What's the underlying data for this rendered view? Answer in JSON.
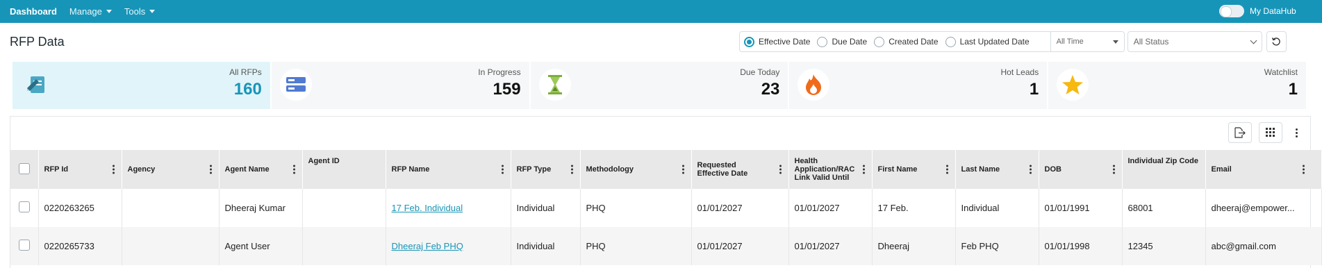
{
  "nav": {
    "items": [
      {
        "label": "Dashboard",
        "active": true,
        "dropdown": false
      },
      {
        "label": "Manage",
        "active": false,
        "dropdown": true
      },
      {
        "label": "Tools",
        "active": false,
        "dropdown": true
      }
    ],
    "toggle_label": "My DataHub",
    "toggle_on": false
  },
  "page": {
    "title": "RFP Data"
  },
  "filters": {
    "radios": [
      {
        "label": "Effective Date",
        "checked": true
      },
      {
        "label": "Due Date",
        "checked": false
      },
      {
        "label": "Created Date",
        "checked": false
      },
      {
        "label": "Last Updated Date",
        "checked": false
      }
    ],
    "time_select": "All Time",
    "status_select": "All Status"
  },
  "cards": [
    {
      "label": "All RFPs",
      "value": "160",
      "icon": "rfp-edit-icon",
      "active": true
    },
    {
      "label": "In Progress",
      "value": "159",
      "icon": "server-stack-icon",
      "active": false
    },
    {
      "label": "Due Today",
      "value": "23",
      "icon": "hourglass-icon",
      "active": false
    },
    {
      "label": "Hot Leads",
      "value": "1",
      "icon": "fire-icon",
      "active": false
    },
    {
      "label": "Watchlist",
      "value": "1",
      "icon": "star-icon",
      "active": false
    }
  ],
  "table": {
    "columns": [
      "RFP Id",
      "Agency",
      "Agent Name",
      "Agent ID",
      "RFP Name",
      "RFP Type",
      "Methodology",
      "Requested Effective Date",
      "Health Application/RAC Link Valid Until",
      "First Name",
      "Last Name",
      "DOB",
      "Individual Zip Code",
      "Email"
    ],
    "rows": [
      [
        "0220263265",
        "",
        "Dheeraj Kumar",
        "",
        "17 Feb. Individual",
        "Individual",
        "PHQ",
        "01/01/2027",
        "01/01/2027",
        "17 Feb.",
        "Individual",
        "01/01/1991",
        "68001",
        "dheeraj@empower..."
      ],
      [
        "0220265733",
        "",
        "Agent User",
        "",
        "Dheeraj Feb PHQ",
        "Individual",
        "PHQ",
        "01/01/2027",
        "01/01/2027",
        "Dheeraj",
        "Feb PHQ",
        "01/01/1998",
        "12345",
        "abc@gmail.com"
      ]
    ]
  },
  "colors": {
    "brand": "#1795b8",
    "active_card_bg": "#e1f4f9"
  }
}
